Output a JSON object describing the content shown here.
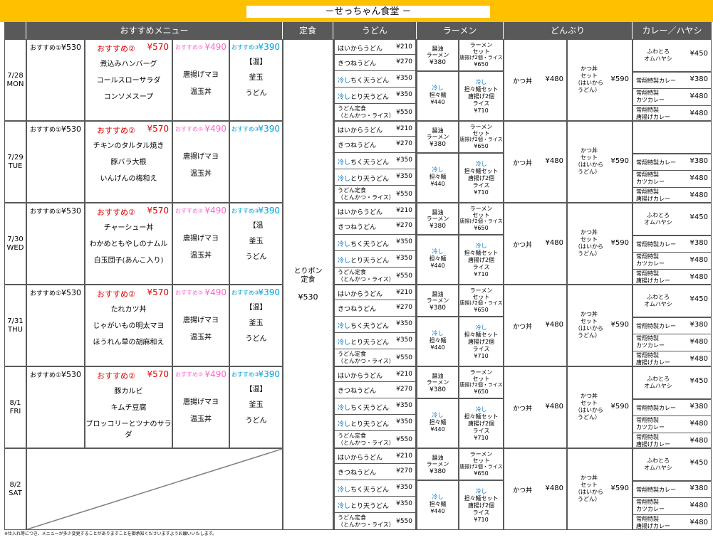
{
  "title": "－せっちゃん食堂 －",
  "headers": [
    "おすすめメニュー",
    "定食",
    "うどん",
    "ラーメン",
    "どんぶり",
    "カレー／ハヤシ"
  ],
  "days": [
    {
      "date": "7/28",
      "dow": "MON"
    },
    {
      "date": "7/29",
      "dow": "TUE"
    },
    {
      "date": "7/30",
      "dow": "WED"
    },
    {
      "date": "7/31",
      "dow": "THU"
    },
    {
      "date": "8/1",
      "dow": "FRI"
    },
    {
      "date": "8/2",
      "dow": "SAT"
    }
  ],
  "rec_labels": {
    "r1": "おすすめ①",
    "r1_price": "¥530",
    "r2": "おすすめ②",
    "r2_price": "¥570",
    "r5": "おすすめ⑤",
    "r5_price": "¥490",
    "r3": "おすすめ③",
    "r3_price": "¥390"
  },
  "rec2_items": [
    [
      "煮込みハンバーグ",
      "コールスローサラダ",
      "コンソメスープ"
    ],
    [
      "チキンのタルタル焼き",
      "豚バラ大根",
      "いんげんの梅和え"
    ],
    [
      "チャーシュー丼",
      "わかめともやしのナムル",
      "白玉団子(あんこ入り)"
    ],
    [
      "たれカツ丼",
      "じゃがいもの明太マヨ",
      "ほうれん草の胡麻和え"
    ],
    [
      "豚カルビ",
      "キムチ豆腐",
      "ブロッコリーとツナのサラダ"
    ]
  ],
  "rec5_items": [
    "唐揚げマヨ",
    "温玉丼"
  ],
  "rec3_items": {
    "full": [
      "【温】",
      "釜玉",
      "うどん"
    ],
    "short": [
      "【温",
      "釜玉",
      "うどん"
    ]
  },
  "teishoku": {
    "name1": "とりポン",
    "name2": "定食",
    "price": "¥530"
  },
  "udon": [
    {
      "name": "はいからうどん",
      "price": "¥210"
    },
    {
      "name": "きつねうどん",
      "price": "¥270"
    },
    {
      "name_a": "冷し",
      "name_b": "ちく天うどん",
      "price": "¥350"
    },
    {
      "name_a": "冷し",
      "name_b": "とり天うどん",
      "price": "¥350"
    },
    {
      "name1": "うどん定食",
      "name2": "（とんかつ・ライス）",
      "price": "¥550"
    }
  ],
  "ramen": {
    "shoyu": [
      "醤油",
      "ラーメン",
      "¥380"
    ],
    "set": [
      "ラーメン",
      "セット",
      "唐揚げ2個・ライス",
      "¥650"
    ],
    "hiyashi": [
      "冷し",
      "担々麺",
      "¥440"
    ],
    "hiyashi_set": [
      "冷し",
      "担々麺セット",
      "唐揚げ2個",
      "ライス",
      "¥710"
    ]
  },
  "donburi": {
    "katsudon": "かつ丼",
    "katsudon_price": "¥480",
    "set": [
      "かつ丼",
      "セット",
      "（はいから",
      "うどん）"
    ],
    "set_price": "¥590"
  },
  "curry": {
    "omu": [
      "ふわとろ",
      "オムハヤシ"
    ],
    "omu_price": "¥450",
    "special": "常翔特製カレー",
    "special_price": "¥380",
    "katsu": [
      "常翔特製",
      "カツカレー"
    ],
    "katsu_price": "¥480",
    "kara": [
      "常翔特製",
      "唐揚げカレー"
    ],
    "kara_price": "¥480"
  },
  "footer": "※仕入れ等につき、メニューが多少変更することがありますことを御承知くださいますようお願いいたします。",
  "colors": {
    "header_bg": "#595959",
    "title_bar": "#ffc000",
    "rec2": "#e00000",
    "rec5": "#ff66cc",
    "rec3": "#00a0d8",
    "hiyashi": "#0070c0"
  }
}
